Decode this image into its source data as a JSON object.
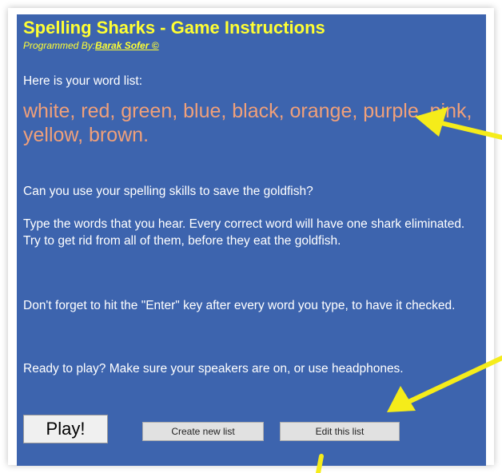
{
  "header": {
    "title": "Spelling Sharks - Game Instructions",
    "byline_prefix": "Programmed By:",
    "author": "Barak Sofer ©"
  },
  "content": {
    "intro": "Here is your word list:",
    "word_list": "white, red, green, blue, black, orange, purple, pink, yellow, brown.",
    "question": "Can you use your spelling skills to save the goldfish?",
    "instructions": "Type the words that you hear. Every correct word will have one shark eliminated. Try to get rid from all of them, before they eat the goldfish.",
    "enter_reminder": "Don't forget to hit the \"Enter\" key after every word you type, to have it checked.",
    "ready": "Ready to play? Make sure your speakers are on, or use headphones."
  },
  "buttons": {
    "play": "Play!",
    "create": "Create new list",
    "edit": "Edit this list"
  },
  "colors": {
    "panel": "#3d64ae",
    "title": "#ffff33",
    "word_list": "#f0a07a",
    "annotation_arrow": "#f5ec1a"
  }
}
